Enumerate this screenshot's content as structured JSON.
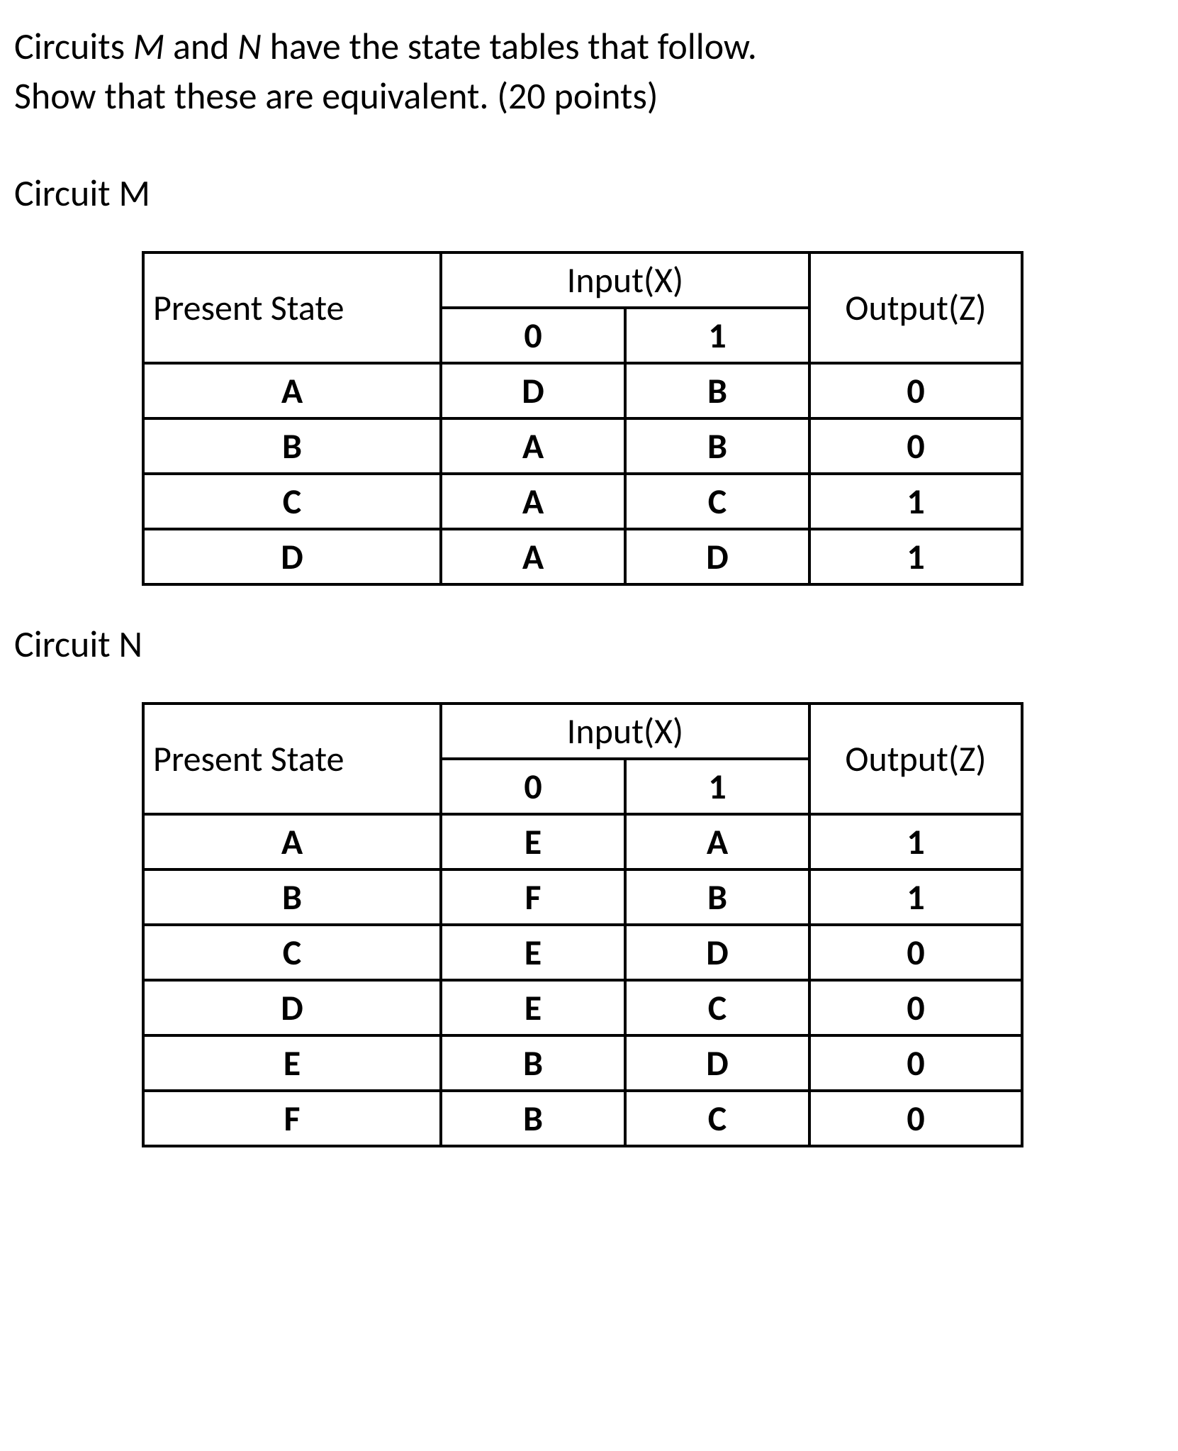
{
  "intro": {
    "line1a": "Circuits ",
    "m": "M",
    "line1b": " and ",
    "n": "N",
    "line1c": " have the state tables that follow.",
    "line2": "Show that these are equivalent. (20 points)"
  },
  "tableHeaders": {
    "presentState": "Present State",
    "inputX": "Input(X)",
    "in0": "0",
    "in1": "1",
    "outputZ": "Output(Z)"
  },
  "circuitM": {
    "label": "Circuit M",
    "rows": [
      {
        "state": "A",
        "x0": "D",
        "x1": "B",
        "z": "0"
      },
      {
        "state": "B",
        "x0": "A",
        "x1": "B",
        "z": "0"
      },
      {
        "state": "C",
        "x0": "A",
        "x1": "C",
        "z": "1"
      },
      {
        "state": "D",
        "x0": "A",
        "x1": "D",
        "z": "1"
      }
    ]
  },
  "circuitN": {
    "label": "Circuit N",
    "rows": [
      {
        "state": "A",
        "x0": "E",
        "x1": "A",
        "z": "1"
      },
      {
        "state": "B",
        "x0": "F",
        "x1": "B",
        "z": "1"
      },
      {
        "state": "C",
        "x0": "E",
        "x1": "D",
        "z": "0"
      },
      {
        "state": "D",
        "x0": "E",
        "x1": "C",
        "z": "0"
      },
      {
        "state": "E",
        "x0": "B",
        "x1": "D",
        "z": "0"
      },
      {
        "state": "F",
        "x0": "B",
        "x1": "C",
        "z": "0"
      }
    ]
  }
}
